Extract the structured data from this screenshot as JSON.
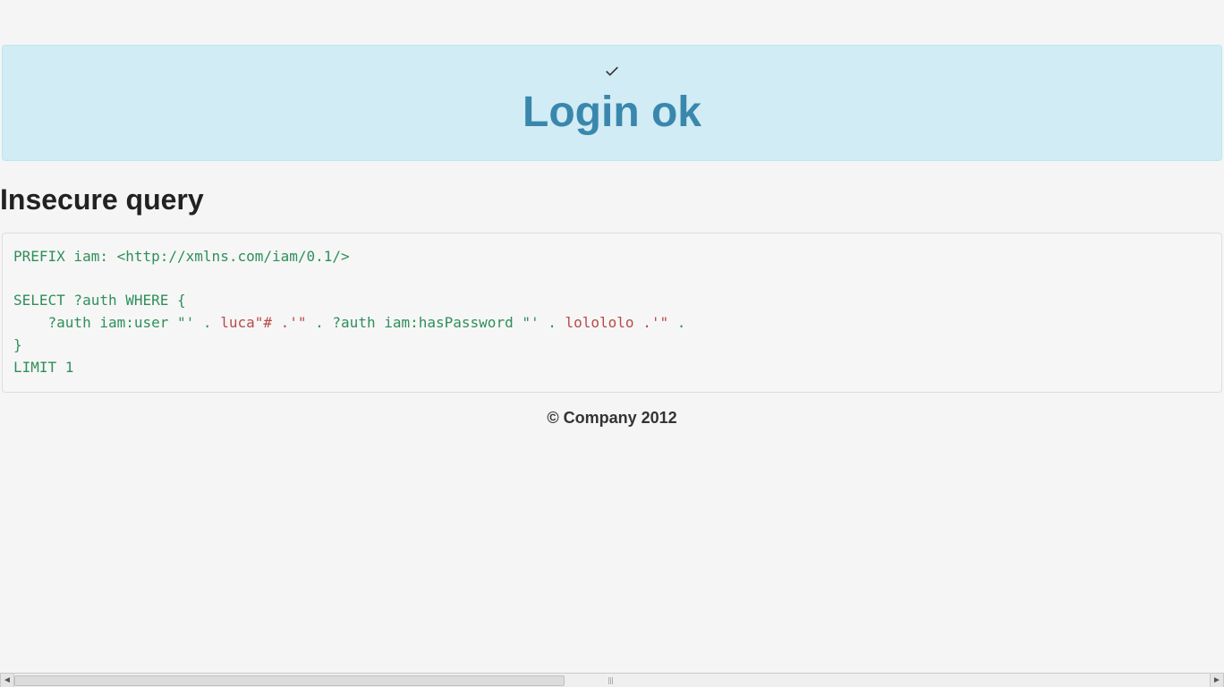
{
  "alert": {
    "title": "Login ok",
    "icon": "check-icon"
  },
  "section": {
    "heading": "Insecure query"
  },
  "code": {
    "line1": "PREFIX iam: <http://xmlns.com/iam/0.1/>",
    "line2": "",
    "line3": "SELECT ?auth WHERE {",
    "line4a": "    ?auth iam:user \"' . ",
    "line4b": "luca\"# .'\"",
    "line4c": " . ?auth iam:hasPassword \"' . ",
    "line4d": "lolololo .'\"",
    "line4e": " . ",
    "line5": "}",
    "line6": "LIMIT 1"
  },
  "footer": {
    "text": "© Company 2012"
  }
}
